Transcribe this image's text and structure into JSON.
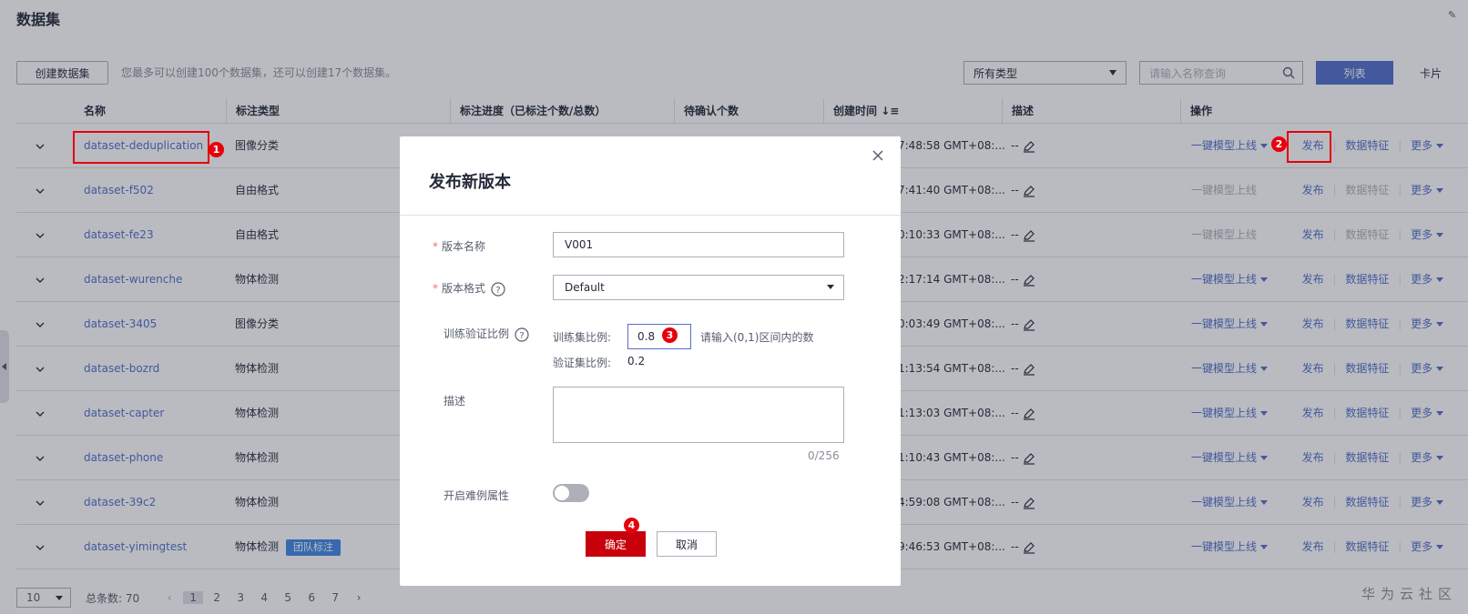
{
  "page": {
    "title": "数据集"
  },
  "toolbar": {
    "create_label": "创建数据集",
    "quota_text": "您最多可以创建100个数据集，还可以创建17个数据集。",
    "type_select": "所有类型",
    "search_placeholder": "请输入名称查询",
    "view_list": "列表",
    "view_card": "卡片"
  },
  "table": {
    "headers": {
      "name": "名称",
      "label_type": "标注类型",
      "progress": "标注进度（已标注个数/总数）",
      "pending": "待确认个数",
      "created": "创建时间",
      "desc": "描述",
      "ops": "操作"
    },
    "rows": [
      {
        "name": "dataset-deduplication",
        "type": "图像分类",
        "time": "7:48:58 GMT+08:...",
        "desc": "--",
        "deploy_enabled": true,
        "feature_enabled": true
      },
      {
        "name": "dataset-f502",
        "type": "自由格式",
        "time": "7:41:40 GMT+08:...",
        "desc": "--",
        "deploy_enabled": false,
        "feature_enabled": false
      },
      {
        "name": "dataset-fe23",
        "type": "自由格式",
        "time": "0:10:33 GMT+08:...",
        "desc": "--",
        "deploy_enabled": false,
        "feature_enabled": false
      },
      {
        "name": "dataset-wurenche",
        "type": "物体检测",
        "time": "2:17:14 GMT+08:...",
        "desc": "--",
        "deploy_enabled": true,
        "feature_enabled": true
      },
      {
        "name": "dataset-3405",
        "type": "图像分类",
        "time": "0:03:49 GMT+08:...",
        "desc": "--",
        "deploy_enabled": true,
        "feature_enabled": true
      },
      {
        "name": "dataset-bozrd",
        "type": "物体检测",
        "time": "1:13:54 GMT+08:...",
        "desc": "--",
        "deploy_enabled": true,
        "feature_enabled": true
      },
      {
        "name": "dataset-capter",
        "type": "物体检测",
        "time": "1:13:03 GMT+08:...",
        "desc": "--",
        "deploy_enabled": true,
        "feature_enabled": true
      },
      {
        "name": "dataset-phone",
        "type": "物体检测",
        "time": "1:10:43 GMT+08:...",
        "desc": "--",
        "deploy_enabled": true,
        "feature_enabled": true
      },
      {
        "name": "dataset-39c2",
        "type": "物体检测",
        "time": "4:59:08 GMT+08:...",
        "desc": "--",
        "deploy_enabled": true,
        "feature_enabled": true
      },
      {
        "name": "dataset-yimingtest",
        "type": "物体检测",
        "tag": "团队标注",
        "time": "9:46:53 GMT+08:...",
        "desc": "--",
        "deploy_enabled": true,
        "feature_enabled": true
      }
    ],
    "ops": {
      "deploy": "一键模型上线",
      "publish": "发布",
      "feature": "数据特征",
      "more": "更多"
    }
  },
  "modal": {
    "title": "发布新版本",
    "version_name_label": "版本名称",
    "version_name_value": "V001",
    "version_format_label": "版本格式",
    "version_format_value": "Default",
    "split_label": "训练验证比例",
    "train_label": "训练集比例:",
    "train_value": "0.8",
    "train_hint": "请输入(0,1)区间内的数",
    "val_label": "验证集比例:",
    "val_value": "0.2",
    "desc_label": "描述",
    "desc_count": "0/256",
    "hard_label": "开启难例属性",
    "hard_enabled": false,
    "ok_label": "确定",
    "cancel_label": "取消"
  },
  "markers": [
    "1",
    "2",
    "3",
    "4"
  ],
  "pagination": {
    "page_size": "10",
    "total": "总条数: 70",
    "pages": [
      "1",
      "2",
      "3",
      "4",
      "5",
      "6",
      "7"
    ],
    "current": "1"
  },
  "watermark": "华为云社区",
  "colors": {
    "brand": "#526ecc",
    "primary_button": "#c7000b",
    "annotation": "#e5000b",
    "tag": "#3f87e5"
  }
}
